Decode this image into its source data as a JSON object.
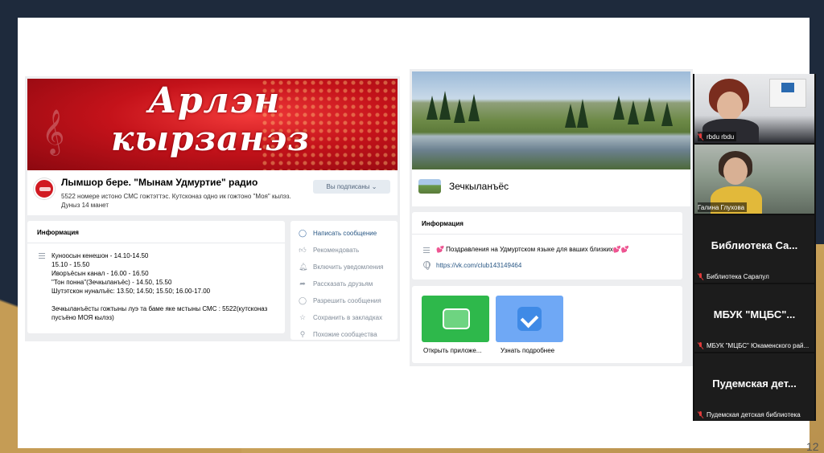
{
  "slide": {
    "page_number": "12"
  },
  "left_group": {
    "banner_line1": "Арлэн",
    "banner_line2": "кырзанэз",
    "name": "Лымшор бере. \"Мынам Удмуртие\" радио",
    "status": "5522 номере истоно СМС гожтэттэс. Кутсконаз одно ик гожтоно \"Моя\" кылэз. Дуныз 14 манет",
    "subscribe_button": "Вы подписаны ⌄",
    "info_title": "Информация",
    "info_lines": [
      "Куноосын кенешон - 14.10-14.50",
      "15.10 - 15.50",
      "Иворъёсын канал - 16.00 - 16.50",
      "\"Тон понна\"(Зечкыланъёс) - 14.50, 15.50",
      "Шутэтскон нуналъёс: 13.50; 14.50; 15.50; 16.00-17.00"
    ],
    "info_extra": "Зечкыланъёсты гожтыны луэ та баме яке мстыны СМС : 5522(кутсконаз пусъёно МОЯ кылэз)",
    "actions": [
      {
        "label": "Написать сообщение",
        "icon": "message-icon"
      },
      {
        "label": "Рекомендовать",
        "icon": "like-icon"
      },
      {
        "label": "Включить уведомления",
        "icon": "bell-icon"
      },
      {
        "label": "Рассказать друзьям",
        "icon": "share-icon"
      },
      {
        "label": "Разрешить сообщения",
        "icon": "chat-icon"
      },
      {
        "label": "Сохранить в закладках",
        "icon": "star-icon"
      },
      {
        "label": "Похожие сообщества",
        "icon": "search-icon"
      }
    ]
  },
  "right_group": {
    "name": "Зечкыланъёс",
    "info_title": "Информация",
    "description": "💕 Поздравления на Удмуртском языке для ваших близких💕💕",
    "link": "https://vk.com/club143149464",
    "apps": [
      {
        "label": "Открыть приложе..."
      },
      {
        "label": "Узнать подробнее"
      }
    ]
  },
  "participants": [
    {
      "name": "rbdu rbdu",
      "big_label": ""
    },
    {
      "name": "Галина Глухова",
      "big_label": ""
    },
    {
      "name": "Библиотека Сарапул",
      "big_label": "Библиотека Са..."
    },
    {
      "name": "МБУК \"МЦБС\" Юкаменского рай...",
      "big_label": "МБУК \"МЦБС\"..."
    },
    {
      "name": "Пудемская детская библиотека",
      "big_label": "Пудемская дет..."
    }
  ]
}
